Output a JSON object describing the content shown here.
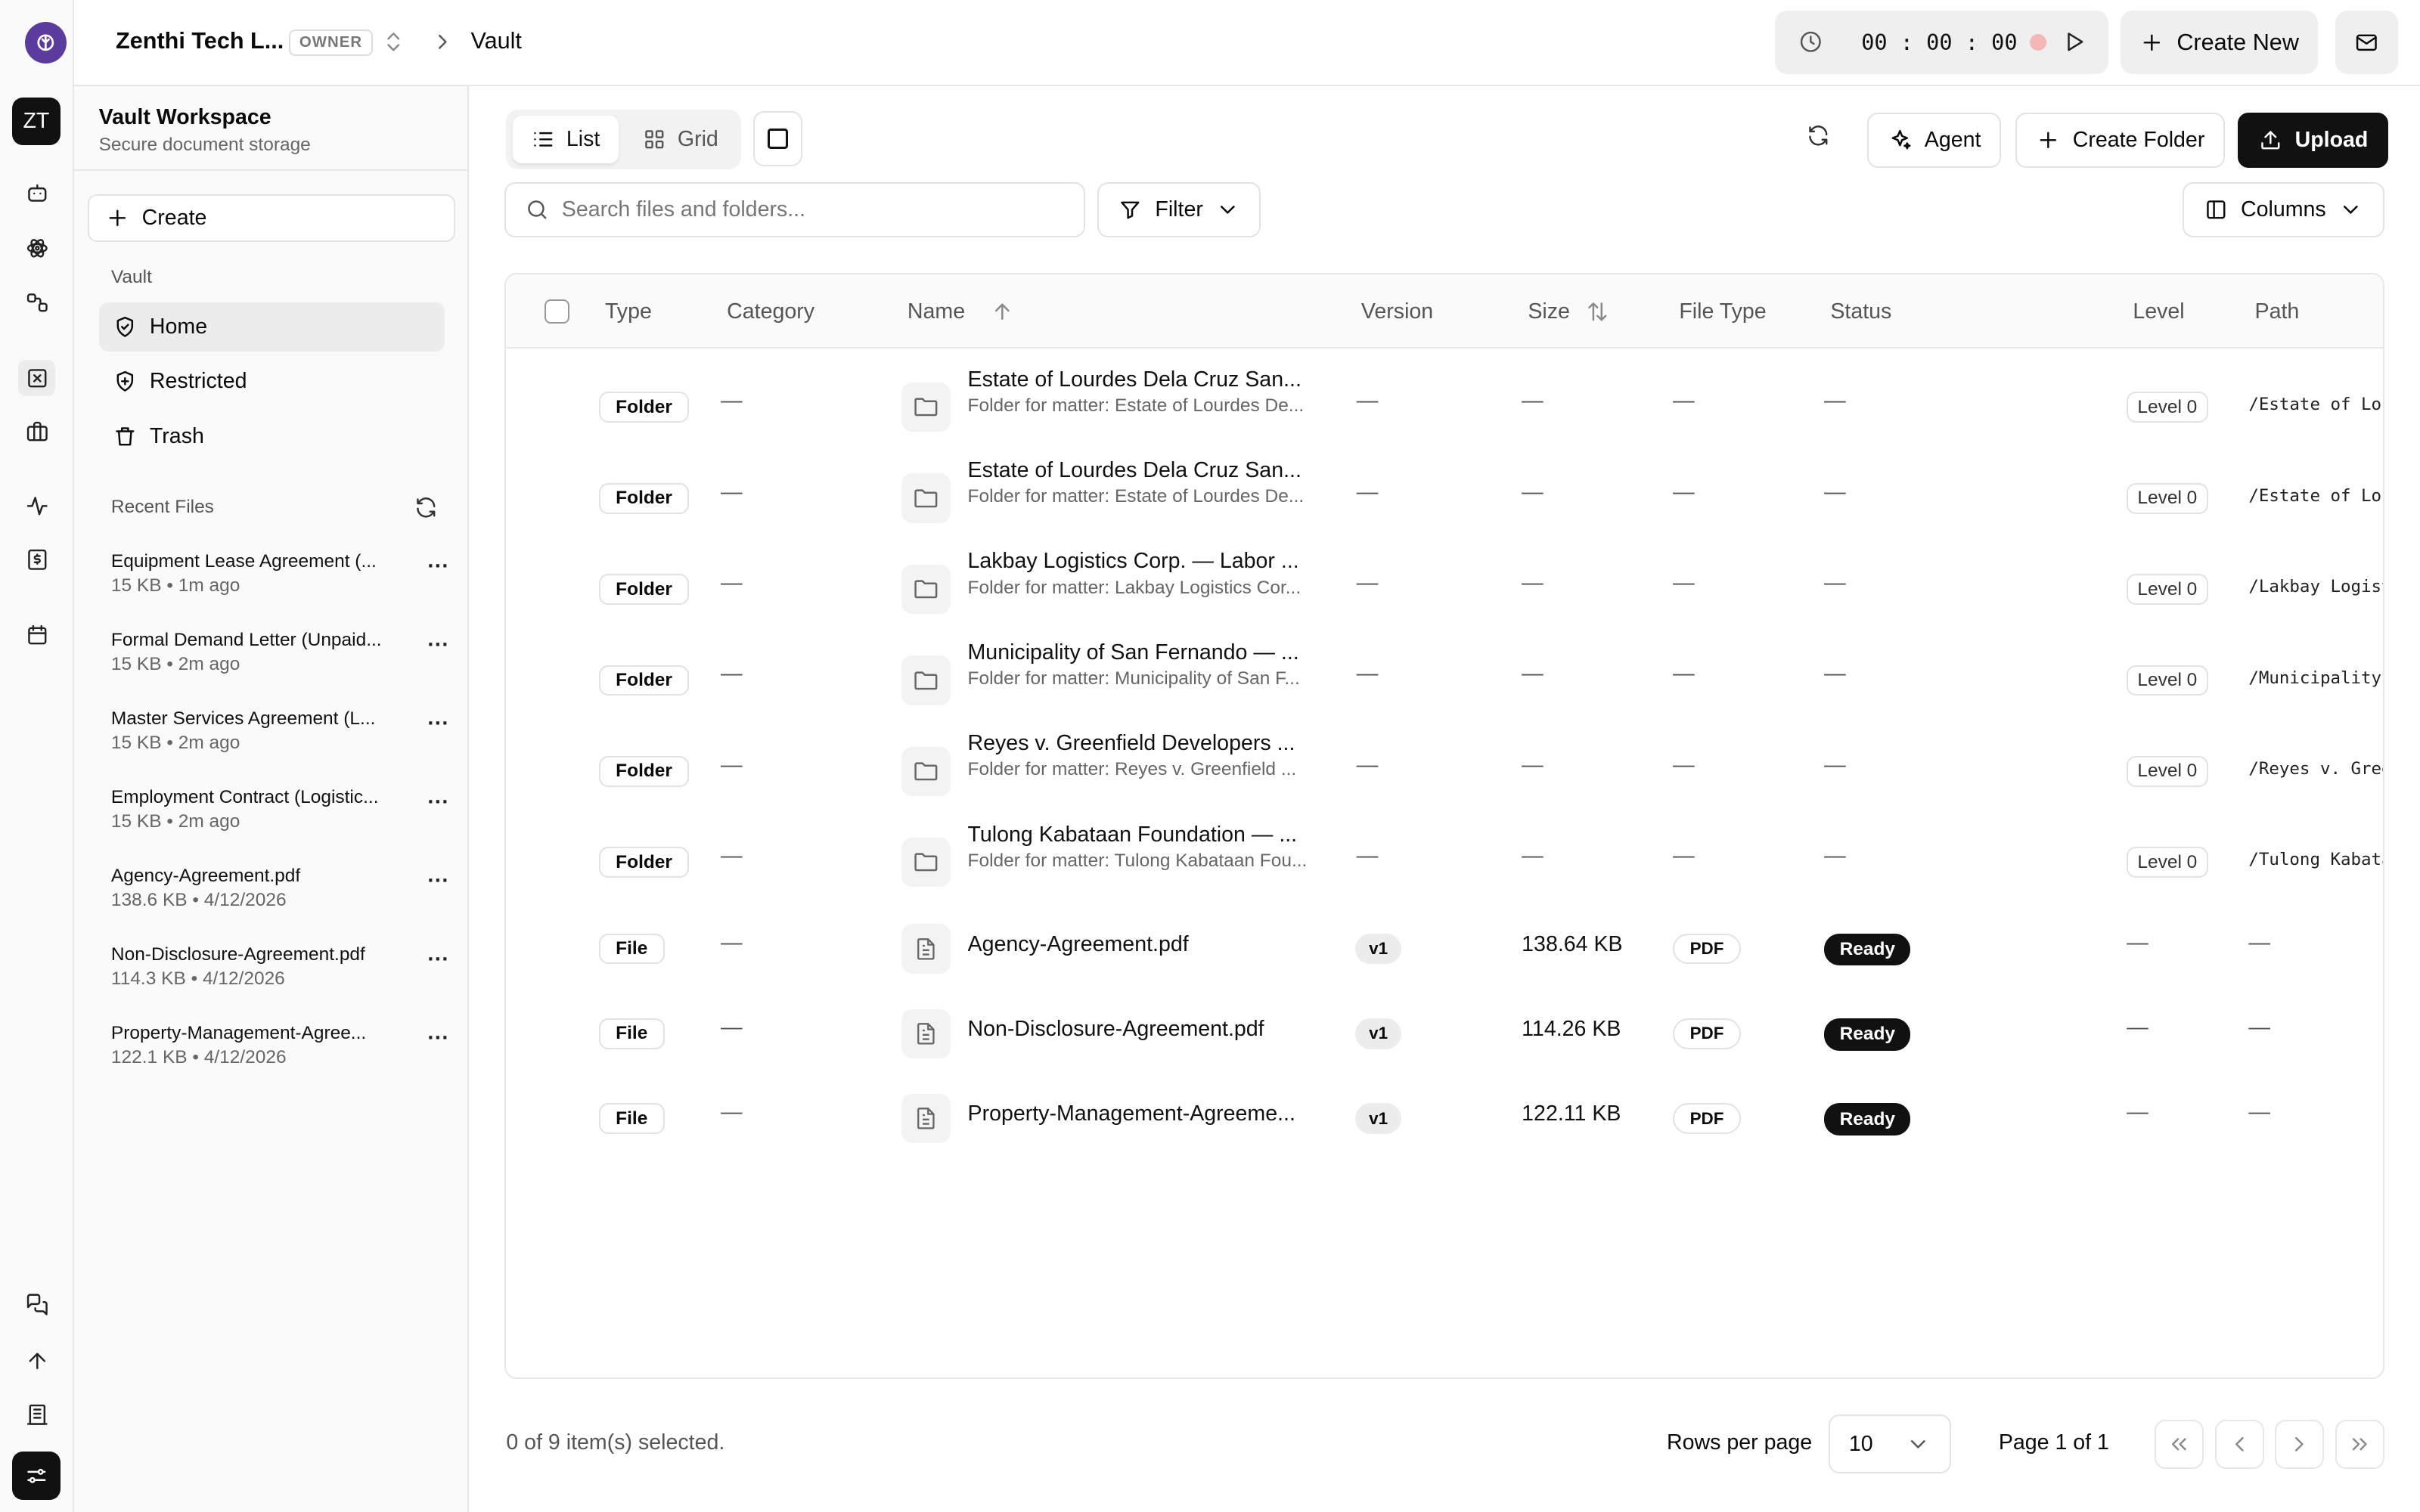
{
  "topbar": {
    "org_name": "Zenthi Tech L...",
    "owner_badge": "OWNER",
    "breadcrumb": "Vault",
    "timer": "00 : 00 : 00",
    "create_new": "Create New"
  },
  "rail": {
    "avatar_initials": "ZT"
  },
  "sidebar": {
    "workspace_title": "Vault Workspace",
    "workspace_subtitle": "Secure document storage",
    "create_label": "Create",
    "group_label": "Vault",
    "nav": [
      {
        "label": "Home",
        "icon": "shield-icon",
        "active": true
      },
      {
        "label": "Restricted",
        "icon": "shield-plus-icon",
        "active": false
      },
      {
        "label": "Trash",
        "icon": "trash-icon",
        "active": false
      }
    ],
    "recent_header": "Recent Files",
    "recent": [
      {
        "name": "Equipment Lease Agreement (...",
        "meta": "15 KB • 1m ago"
      },
      {
        "name": "Formal Demand Letter (Unpaid...",
        "meta": "15 KB • 2m ago"
      },
      {
        "name": "Master Services Agreement (L...",
        "meta": "15 KB • 2m ago"
      },
      {
        "name": "Employment Contract (Logistic...",
        "meta": "15 KB • 2m ago"
      },
      {
        "name": "Agency-Agreement.pdf",
        "meta": "138.6 KB • 4/12/2026"
      },
      {
        "name": "Non-Disclosure-Agreement.pdf",
        "meta": "114.3 KB • 4/12/2026"
      },
      {
        "name": "Property-Management-Agree...",
        "meta": "122.1 KB • 4/12/2026"
      }
    ]
  },
  "toolbar": {
    "list_label": "List",
    "grid_label": "Grid",
    "agent_label": "Agent",
    "create_folder_label": "Create Folder",
    "upload_label": "Upload",
    "search_placeholder": "Search files and folders...",
    "filter_label": "Filter",
    "columns_label": "Columns"
  },
  "table": {
    "columns": [
      "Type",
      "Category",
      "Name",
      "Version",
      "Size",
      "File Type",
      "Status",
      "Level",
      "Path"
    ],
    "dash": "—",
    "rows": [
      {
        "type": "Folder",
        "name": "Estate of Lourdes Dela Cruz San...",
        "sub": "Folder for matter: Estate of Lourdes De...",
        "level": "Level 0",
        "path": "/Estate of Lourdes"
      },
      {
        "type": "Folder",
        "name": "Estate of Lourdes Dela Cruz San...",
        "sub": "Folder for matter: Estate of Lourdes De...",
        "level": "Level 0",
        "path": "/Estate of Lourdes"
      },
      {
        "type": "Folder",
        "name": "Lakbay Logistics Corp. — Labor ...",
        "sub": "Folder for matter: Lakbay Logistics Cor...",
        "level": "Level 0",
        "path": "/Lakbay Logistics"
      },
      {
        "type": "Folder",
        "name": "Municipality of San Fernando — ...",
        "sub": "Folder for matter: Municipality of San F...",
        "level": "Level 0",
        "path": "/Municipality of"
      },
      {
        "type": "Folder",
        "name": "Reyes v. Greenfield Developers ...",
        "sub": "Folder for matter: Reyes v. Greenfield ...",
        "level": "Level 0",
        "path": "/Reyes v. Greenfield"
      },
      {
        "type": "Folder",
        "name": "Tulong Kabataan Foundation — ...",
        "sub": "Folder for matter: Tulong Kabataan Fou...",
        "level": "Level 0",
        "path": "/Tulong Kabataan"
      },
      {
        "type": "File",
        "name": "Agency-Agreement.pdf",
        "version": "v1",
        "size": "138.64 KB",
        "filetype": "PDF",
        "status": "Ready"
      },
      {
        "type": "File",
        "name": "Non-Disclosure-Agreement.pdf",
        "version": "v1",
        "size": "114.26 KB",
        "filetype": "PDF",
        "status": "Ready"
      },
      {
        "type": "File",
        "name": "Property-Management-Agreeme...",
        "version": "v1",
        "size": "122.11 KB",
        "filetype": "PDF",
        "status": "Ready"
      }
    ]
  },
  "footer": {
    "selected": "0 of 9 item(s) selected.",
    "rows_per_page_label": "Rows per page",
    "rows_per_page": "10",
    "page": "Page 1 of 1"
  },
  "colors": {
    "brand": "#5b3c9c",
    "ready": "#111111",
    "record": "#f4b6b6"
  }
}
